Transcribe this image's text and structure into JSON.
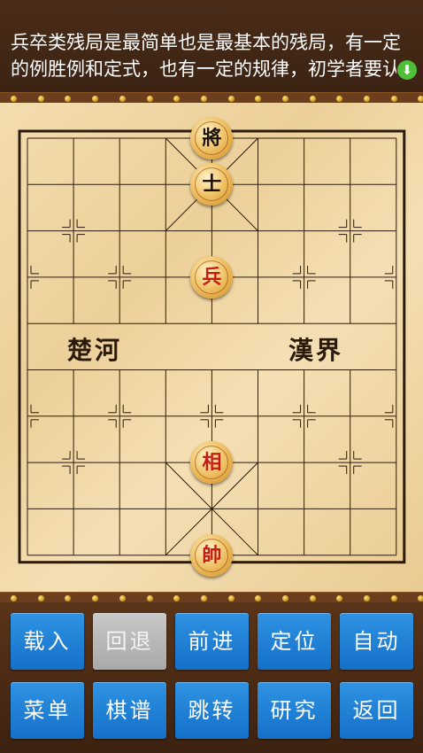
{
  "header": {
    "intro_line1": "兵卒类残局是最简单也是最基本的残局，有一定",
    "intro_line2": "的例胜例和定式，也有一定的规律，初学者要认",
    "expand_icon": "expand-down-icon"
  },
  "board": {
    "river_left": "楚河",
    "river_right": "漢界",
    "colors": {
      "red_piece_text": "#c41e14",
      "black_piece_text": "#1b120a"
    },
    "pieces": [
      {
        "char": "將",
        "side": "black",
        "file": 4,
        "rank": 0
      },
      {
        "char": "士",
        "side": "black",
        "file": 4,
        "rank": 1
      },
      {
        "char": "兵",
        "side": "red",
        "file": 4,
        "rank": 3
      },
      {
        "char": "相",
        "side": "red",
        "file": 4,
        "rank": 7
      },
      {
        "char": "帥",
        "side": "red",
        "file": 4,
        "rank": 9
      }
    ]
  },
  "toolbar": {
    "buttons": [
      {
        "label": "载入",
        "enabled": true
      },
      {
        "label": "回退",
        "enabled": false
      },
      {
        "label": "前进",
        "enabled": true
      },
      {
        "label": "定位",
        "enabled": true
      },
      {
        "label": "自动",
        "enabled": true
      },
      {
        "label": "菜单",
        "enabled": true
      },
      {
        "label": "棋谱",
        "enabled": true
      },
      {
        "label": "跳转",
        "enabled": true
      },
      {
        "label": "研究",
        "enabled": true
      },
      {
        "label": "返回",
        "enabled": true
      }
    ]
  }
}
